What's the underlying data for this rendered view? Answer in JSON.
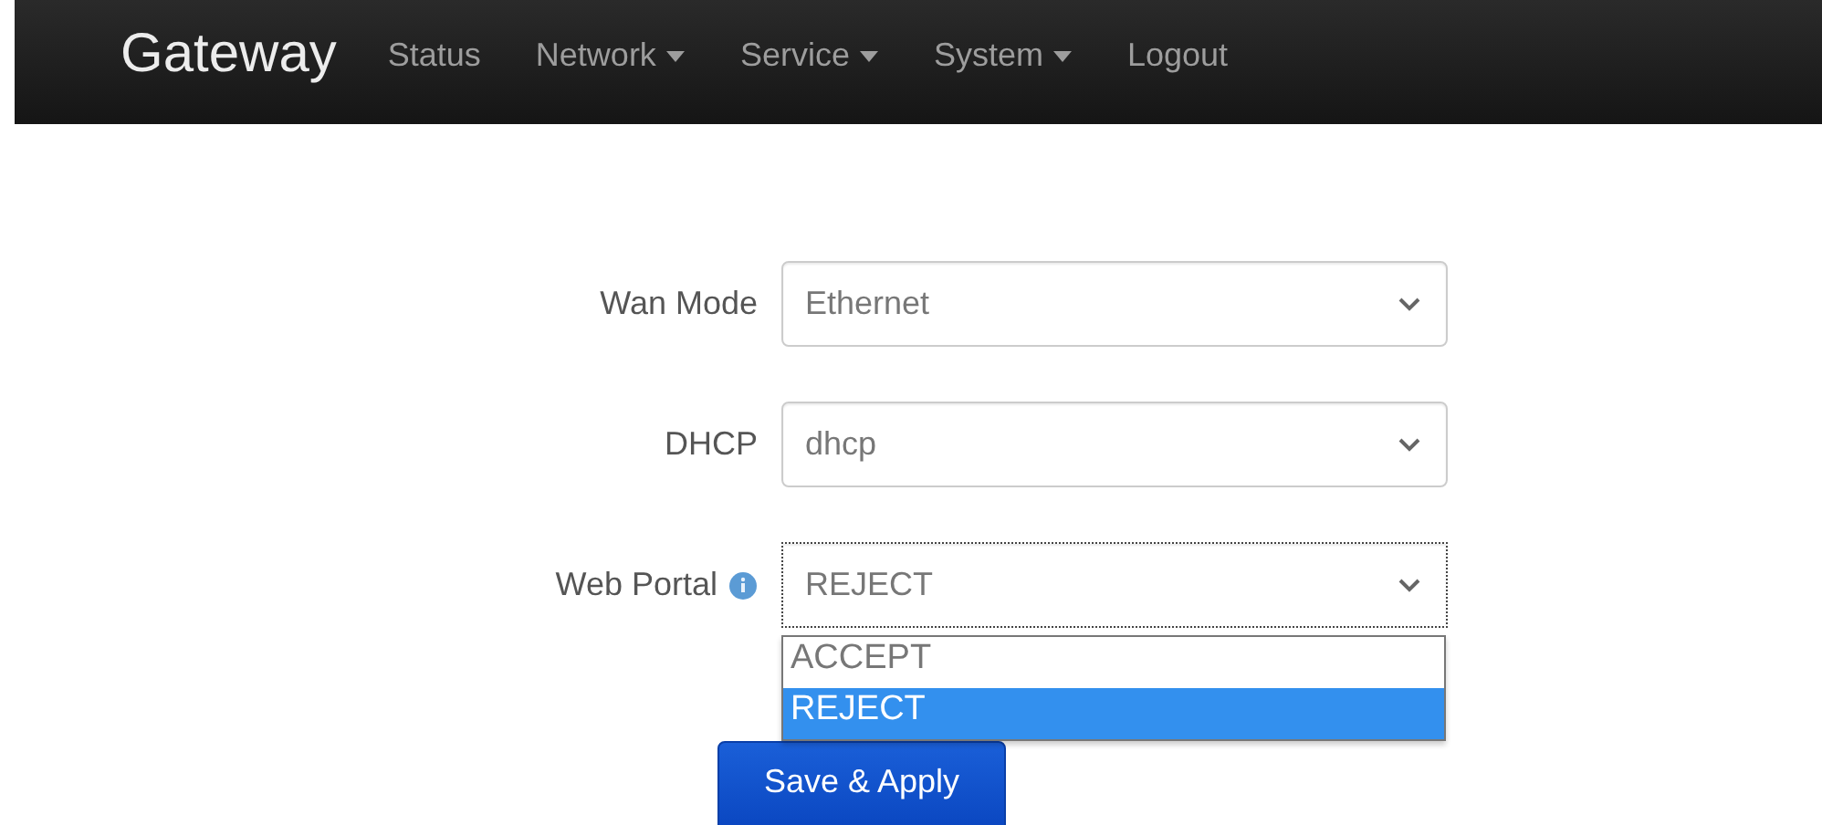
{
  "navbar": {
    "brand": "Gateway",
    "items": [
      {
        "label": "Status",
        "has_menu": false
      },
      {
        "label": "Network",
        "has_menu": true
      },
      {
        "label": "Service",
        "has_menu": true
      },
      {
        "label": "System",
        "has_menu": true
      },
      {
        "label": "Logout",
        "has_menu": false
      }
    ]
  },
  "form": {
    "fields": [
      {
        "label": "Wan Mode",
        "value": "Ethernet",
        "help": false,
        "focused": false
      },
      {
        "label": "DHCP",
        "value": "dhcp",
        "help": false,
        "focused": false
      },
      {
        "label": "Web Portal",
        "value": "REJECT",
        "help": true,
        "focused": true,
        "open_options": [
          {
            "label": "ACCEPT",
            "selected": false
          },
          {
            "label": "REJECT",
            "selected": true
          }
        ]
      }
    ],
    "submit": "Save & Apply"
  }
}
